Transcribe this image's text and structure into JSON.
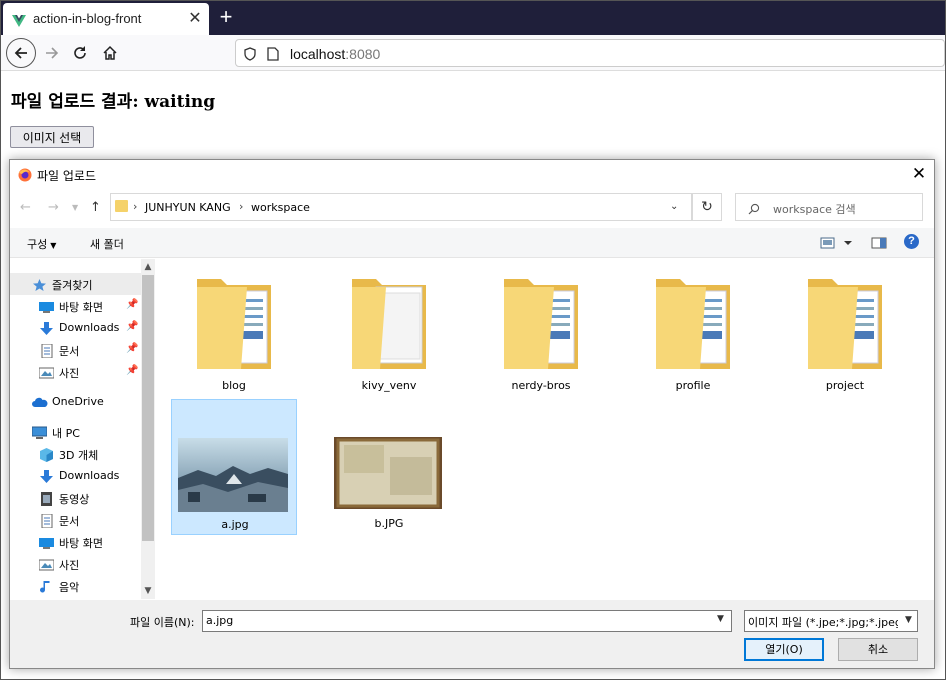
{
  "browser": {
    "tab_title": "action-in-blog-front",
    "url_host": "localhost",
    "url_port": ":8080"
  },
  "page": {
    "heading": "파일 업로드 결과: waiting",
    "select_button": "이미지 선택"
  },
  "dialog": {
    "title": "파일 업로드",
    "breadcrumb": [
      "JUNHYUN KANG",
      "workspace"
    ],
    "search_placeholder": "workspace 검색",
    "commands": {
      "organize": "구성",
      "new_folder": "새 폴더"
    },
    "nav": [
      {
        "label": "즐겨찾기",
        "icon": "star-icon",
        "pinned": false,
        "selected": true
      },
      {
        "label": "바탕 화면",
        "icon": "desktop-icon",
        "pinned": true
      },
      {
        "label": "Downloads",
        "icon": "download-icon",
        "pinned": true
      },
      {
        "label": "문서",
        "icon": "document-icon",
        "pinned": true
      },
      {
        "label": "사진",
        "icon": "picture-icon",
        "pinned": true
      },
      {
        "label": "OneDrive",
        "icon": "cloud-icon"
      },
      {
        "label": "내 PC",
        "icon": "pc-icon"
      },
      {
        "label": "3D 개체",
        "icon": "cube-icon"
      },
      {
        "label": "Downloads",
        "icon": "download-icon"
      },
      {
        "label": "동영상",
        "icon": "video-icon"
      },
      {
        "label": "문서",
        "icon": "document-icon"
      },
      {
        "label": "바탕 화면",
        "icon": "desktop-icon"
      },
      {
        "label": "사진",
        "icon": "picture-icon"
      },
      {
        "label": "음악",
        "icon": "music-icon"
      }
    ],
    "files": [
      {
        "name": "blog",
        "type": "folder"
      },
      {
        "name": "kivy_venv",
        "type": "folder"
      },
      {
        "name": "nerdy-bros",
        "type": "folder"
      },
      {
        "name": "profile",
        "type": "folder"
      },
      {
        "name": "project",
        "type": "folder"
      },
      {
        "name": "a.jpg",
        "type": "image",
        "selected": true
      },
      {
        "name": "b.JPG",
        "type": "image"
      }
    ],
    "filename_label": "파일 이름(N):",
    "filename_value": "a.jpg",
    "filetype_value": "이미지 파일 (*.jpe;*.jpg;*.jpeg;*",
    "open_button": "열기(O)",
    "cancel_button": "취소"
  },
  "colors": {
    "accent": "#0078d7",
    "selection": "#cce8ff",
    "folder": "#f5d26a"
  }
}
